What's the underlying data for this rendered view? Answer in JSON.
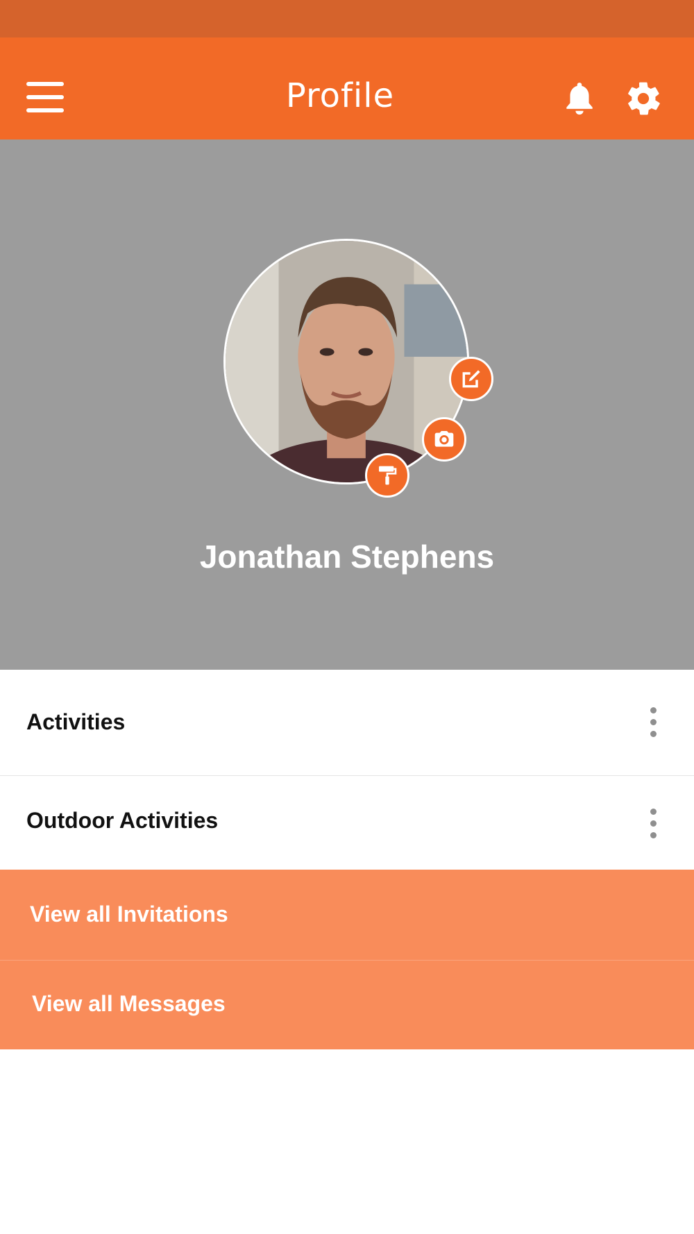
{
  "app_bar": {
    "title": "Profile",
    "menu_icon": "hamburger-menu-icon",
    "notifications_icon": "bell-icon",
    "settings_icon": "gear-icon"
  },
  "profile": {
    "name": "Jonathan Stephens",
    "avatar": "profile-photo",
    "badges": [
      "edit-icon",
      "camera-icon",
      "paint-roller-icon"
    ]
  },
  "sections": [
    {
      "label": "Activities",
      "icon": "more-vertical-icon"
    },
    {
      "label": "Outdoor Activities",
      "icon": "more-vertical-icon"
    }
  ],
  "actions": [
    {
      "label": "View all Invitations"
    },
    {
      "label": "View all Messages"
    }
  ],
  "colors": {
    "status_bar": "#d5632c",
    "primary": "#f26a27",
    "action_row": "#f98c5a",
    "hero_bg": "#9c9c9c"
  }
}
